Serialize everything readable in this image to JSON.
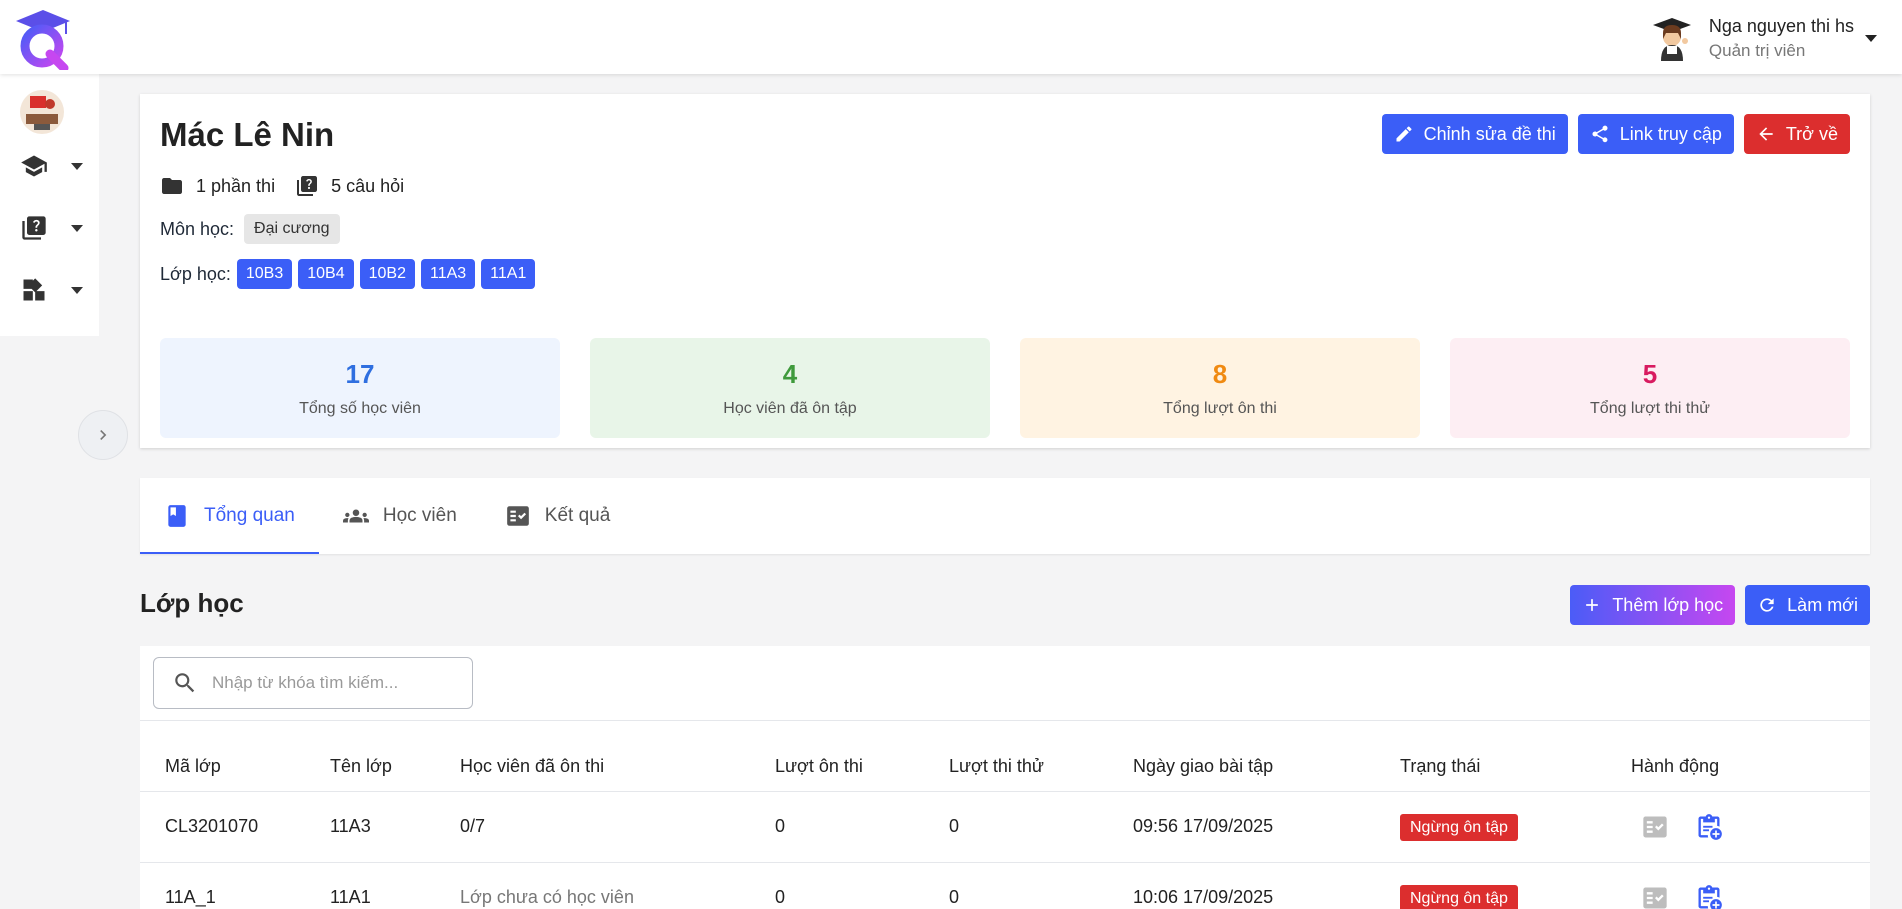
{
  "user": {
    "name": "Nga nguyen thi hs",
    "role": "Quản trị viên"
  },
  "sidebar": {
    "items": [
      {
        "icon": "graduation-cap-icon"
      },
      {
        "icon": "quiz-icon"
      },
      {
        "icon": "dashboard-icon"
      }
    ]
  },
  "exam": {
    "title": "Mác Lê Nin",
    "parts": "1 phần thi",
    "questions": "5 câu hỏi",
    "subject_label": "Môn học:",
    "subject": "Đại cương",
    "classes_label": "Lớp học:",
    "classes": [
      "10B3",
      "10B4",
      "10B2",
      "11A3",
      "11A1"
    ]
  },
  "actions": {
    "edit": "Chỉnh sửa đề thi",
    "link": "Link truy cập",
    "back": "Trở về"
  },
  "stats": [
    {
      "value": "17",
      "label": "Tổng số học viên",
      "color": "#2f6fe0",
      "bg": "#eef4fe"
    },
    {
      "value": "4",
      "label": "Học viên đã ôn tập",
      "color": "#3f9a3c",
      "bg": "#e8f5e8"
    },
    {
      "value": "8",
      "label": "Tổng lượt ôn thi",
      "color": "#f08a12",
      "bg": "#fff3e2"
    },
    {
      "value": "5",
      "label": "Tổng lượt thi thử",
      "color": "#d81b60",
      "bg": "#fdeef3"
    }
  ],
  "tabs": [
    "Tổng quan",
    "Học viên",
    "Kết quả"
  ],
  "section": {
    "title": "Lớp học",
    "add": "Thêm lớp học",
    "refresh": "Làm mới"
  },
  "search": {
    "placeholder": "Nhập từ khóa tìm kiếm..."
  },
  "table": {
    "headers": [
      "Mã lớp",
      "Tên lớp",
      "Học viên đã ôn thi",
      "Lượt ôn thi",
      "Lượt thi thử",
      "Ngày giao bài tập",
      "Trạng thái",
      "Hành động"
    ],
    "rows": [
      {
        "code": "CL3201070",
        "name": "11A3",
        "students": "0/7",
        "reviews": "0",
        "trials": "0",
        "date": "09:56 17/09/2025",
        "status": "Ngừng ôn tập"
      },
      {
        "code": "11A_1",
        "name": "11A1",
        "students": "Lớp chưa có học viên",
        "reviews": "0",
        "trials": "0",
        "date": "10:06 17/09/2025",
        "status": "Ngừng ôn tập"
      }
    ]
  }
}
